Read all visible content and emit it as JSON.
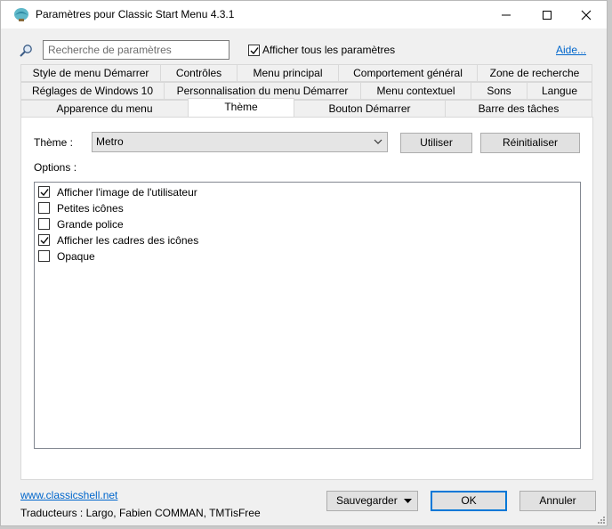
{
  "window": {
    "title": "Paramètres pour Classic Start Menu 4.3.1",
    "icon": "classic-shell-shell-icon"
  },
  "search": {
    "placeholder": "Recherche de paramètres",
    "value": "",
    "icon": "search-icon"
  },
  "show_all": {
    "label": "Afficher tous les paramètres",
    "checked": true
  },
  "help_link": "Aide...",
  "tabs": {
    "row1": [
      "Style de menu Démarrer",
      "Contrôles",
      "Menu principal",
      "Comportement général",
      "Zone de recherche"
    ],
    "row2": [
      "Réglages de Windows 10",
      "Personnalisation du menu Démarrer",
      "Menu contextuel",
      "Sons",
      "Langue"
    ],
    "row3": [
      "Apparence du menu",
      "Thème",
      "Bouton Démarrer",
      "Barre des tâches"
    ],
    "active": "Thème"
  },
  "theme": {
    "label": "Thème :",
    "selected": "Metro",
    "use_button": "Utiliser",
    "reset_button": "Réinitialiser"
  },
  "options": {
    "label": "Options :",
    "items": [
      {
        "label": "Afficher l'image de l'utilisateur",
        "checked": true
      },
      {
        "label": "Petites icônes",
        "checked": false
      },
      {
        "label": "Grande police",
        "checked": false
      },
      {
        "label": "Afficher les cadres des icônes",
        "checked": true
      },
      {
        "label": "Opaque",
        "checked": false
      }
    ]
  },
  "footer": {
    "site_link": "www.classicshell.net",
    "translators": "Traducteurs : Largo, Fabien COMMAN, TMTisFree",
    "save_button": "Sauvegarder",
    "ok_button": "OK",
    "cancel_button": "Annuler"
  },
  "colors": {
    "link": "#0066cc",
    "default_button_border": "#0078d7"
  }
}
